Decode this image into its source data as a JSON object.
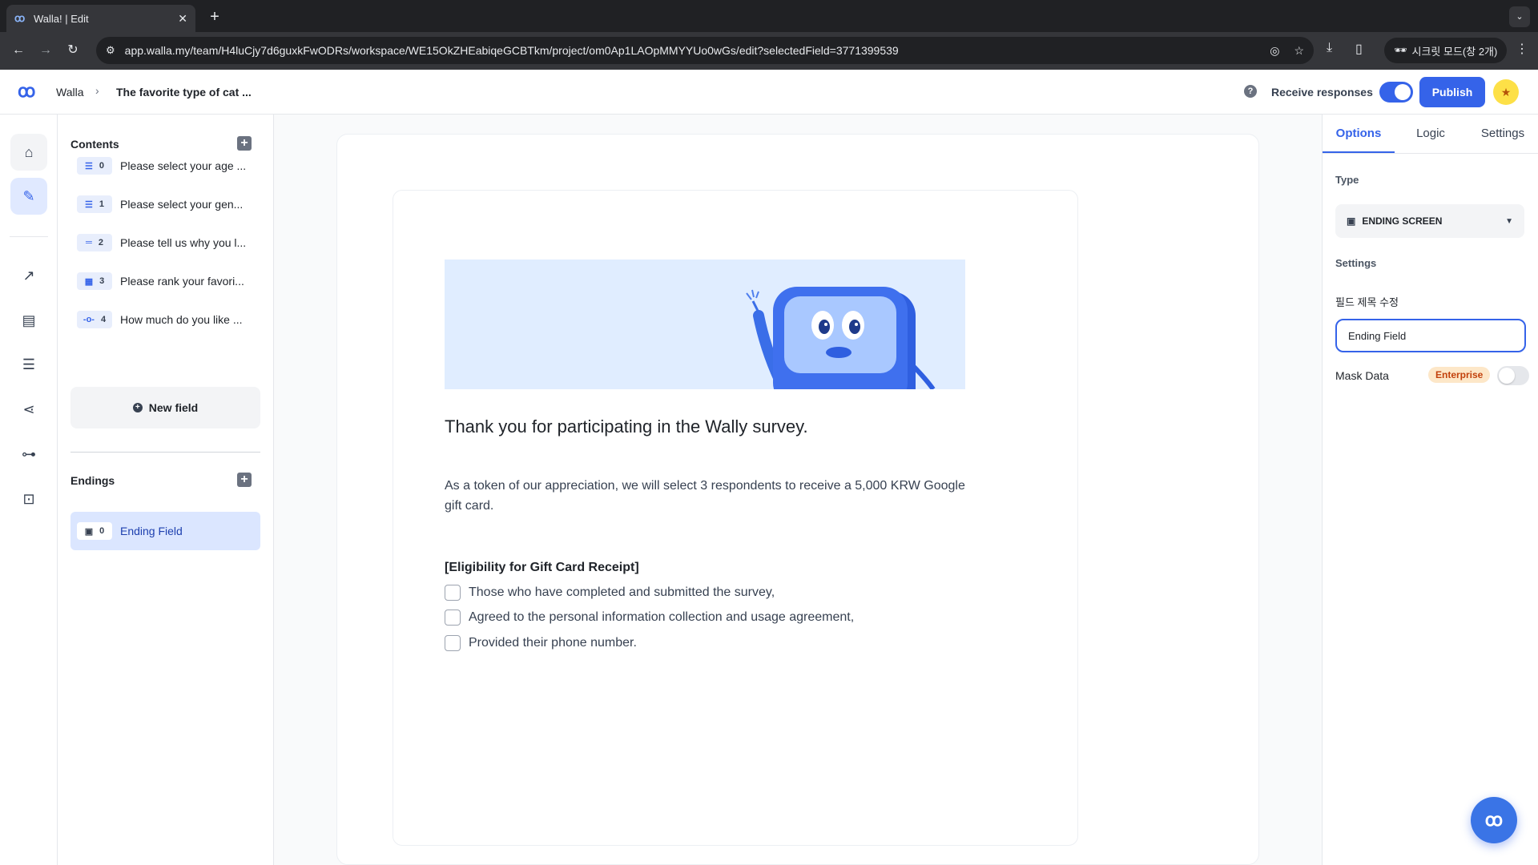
{
  "browser": {
    "tab_title": "Walla! | Edit",
    "favicon": "ꝏ",
    "url": "app.walla.my/team/H4luCjy7d6guxkFwODRs/workspace/WE15OkZHEabiqeGCBTkm/project/om0Ap1LAOpMMYYUo0wGs/edit?selectedField=3771399539",
    "incognito_label": "시크릿 모드(창 2개)"
  },
  "header": {
    "logo": "ꝏ",
    "breadcrumb": [
      "Walla",
      "The favorite type of cat ..."
    ],
    "receive_label": "Receive responses",
    "receive_on": true,
    "publish_label": "Publish"
  },
  "contents": {
    "title": "Contents",
    "items": [
      {
        "index": "0",
        "icon": "list-icon",
        "label": "Please select your age ..."
      },
      {
        "index": "1",
        "icon": "list-icon",
        "label": "Please select your gen..."
      },
      {
        "index": "2",
        "icon": "text-icon",
        "label": "Please tell us why you l..."
      },
      {
        "index": "3",
        "icon": "grid-icon",
        "label": "Please rank your favori..."
      },
      {
        "index": "4",
        "icon": "slider-icon",
        "label": "How much do you like ..."
      }
    ],
    "new_field_label": "New field"
  },
  "endings": {
    "title": "Endings",
    "items": [
      {
        "index": "0",
        "icon": "clipboard-icon",
        "label": "Ending Field"
      }
    ]
  },
  "ending_screen": {
    "title": "Thank you for participating in the Wally survey.",
    "description": "As a token of our appreciation, we will select 3 respondents to receive a 5,000 KRW Google gift card.",
    "eligibility_heading": "[Eligibility for Gift Card Receipt]",
    "criteria": [
      "Those who have completed and submitted the survey,",
      "Agreed to the personal information collection and usage agreement,",
      "Provided their phone number."
    ]
  },
  "right_panel": {
    "tabs": [
      "Options",
      "Logic",
      "Settings"
    ],
    "active_tab": "Options",
    "type_label": "Type",
    "type_value": "ENDING SCREEN",
    "settings_label": "Settings",
    "field_title_label": "필드 제목 수정",
    "field_title_value": "Ending Field",
    "mask_label": "Mask Data",
    "mask_badge": "Enterprise",
    "mask_on": false
  },
  "colors": {
    "accent": "#3563e9",
    "active_item_bg": "#dbe6ff",
    "banner_bg": "#e0edff",
    "enterprise_bg": "#fde7c8"
  }
}
